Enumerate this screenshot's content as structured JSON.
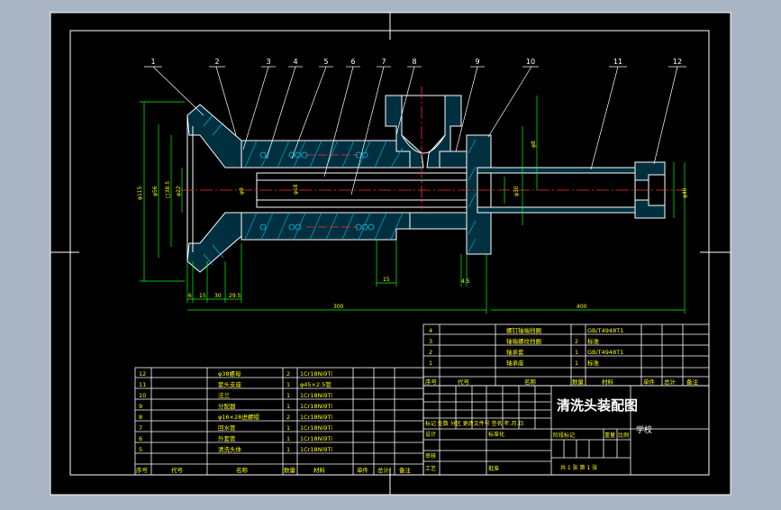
{
  "colors": {
    "background": "#a9b5c4",
    "sheet": "#000000",
    "frame": "#ffffff",
    "part": "#ffffff",
    "dim": "#00ff00",
    "hatch": "#00ffff",
    "center": "#ff0000",
    "label": "#ffff00"
  },
  "drawing": {
    "title": "清洗头装配图",
    "school": "学校"
  },
  "balloons": [
    "1",
    "2",
    "3",
    "4",
    "5",
    "6",
    "7",
    "8",
    "9",
    "10",
    "11",
    "12"
  ],
  "dimensions": {
    "left_height": "φ115",
    "d2": "φ56",
    "d3": "□38.5",
    "d4": "φ22",
    "d5": "φ9",
    "bore": "φ18",
    "b1": "6",
    "b2": "15",
    "b3": "30",
    "b4": "29.5",
    "total": "300",
    "gap": "15",
    "small": "4.5",
    "right_len": "400",
    "right_dia": "φ40",
    "rh": "φ8",
    "rm": "φ30"
  },
  "upper_bom": [
    {
      "no": "4",
      "name": "螺钉轴端挡圈",
      "qty": "",
      "mat": "GB/T4948T1"
    },
    {
      "no": "3",
      "name": "轴端螺纹挡圈",
      "qty": "2",
      "mat": "标准"
    },
    {
      "no": "2",
      "name": "轴承套",
      "qty": "1",
      "mat": "GB/T4948T1"
    },
    {
      "no": "1",
      "name": "轴承座",
      "qty": "1",
      "mat": "标准"
    }
  ],
  "upper_header": {
    "no": "序号",
    "code": "代号",
    "name": "名称",
    "qty": "数量",
    "mat": "材料",
    "mass1": "单件",
    "mass2": "总计",
    "note": "备注"
  },
  "lower_bom": [
    {
      "no": "12",
      "name": "φ38螺母",
      "qty": "2",
      "mat": "1Cr18Ni9Ti"
    },
    {
      "no": "11",
      "name": "套头支座",
      "qty": "1",
      "mat": "φ45×2.5管"
    },
    {
      "no": "10",
      "name": "法兰",
      "qty": "1",
      "mat": "1Cr18Ni9Ti"
    },
    {
      "no": "9",
      "name": "分配器",
      "qty": "1",
      "mat": "1Cr18Ni9Ti"
    },
    {
      "no": "8",
      "name": "φ16×28进螺帽",
      "qty": "2",
      "mat": "1Cr18Ni9Ti"
    },
    {
      "no": "7",
      "name": "回水管",
      "qty": "1",
      "mat": "1Cr18Ni9Ti"
    },
    {
      "no": "6",
      "name": "外套管",
      "qty": "1",
      "mat": "1Cr18Ni9Ti"
    },
    {
      "no": "5",
      "name": "清洗头体",
      "qty": "1",
      "mat": "1Cr18Ni9Ti"
    }
  ],
  "lower_header": {
    "no": "序号",
    "code": "代号",
    "name": "名称",
    "qty": "数量",
    "mat": "材料",
    "mass1": "单件",
    "mass2": "总计",
    "note": "备注"
  },
  "title_block": {
    "rev_row": "标记 处数 分区 更改文件号 签名 年.月.日",
    "design": "设计",
    "standard": "标准化",
    "review": "审核",
    "process": "工艺",
    "approve": "批准",
    "stage": "阶段标记",
    "weight": "重量",
    "scale": "比例",
    "sheets": "共 1 张   第 1 张"
  }
}
